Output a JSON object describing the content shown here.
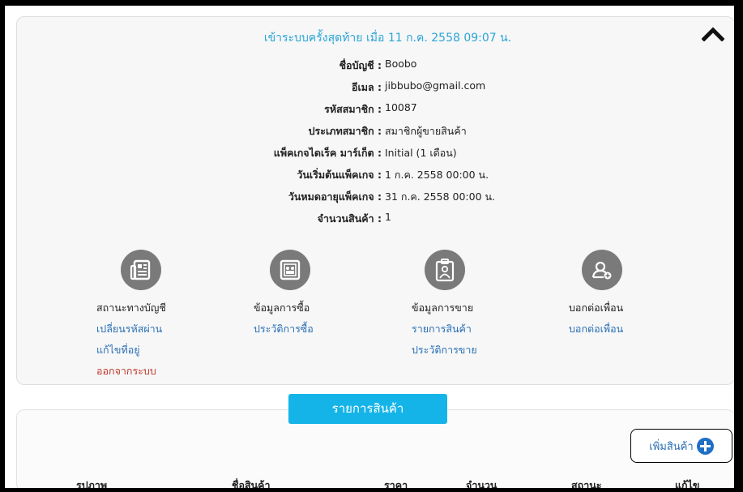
{
  "last_login": "เข้าระบบครั้งสุดท้าย เมื่อ 11 ก.ค. 2558 09:07 น.",
  "account": [
    {
      "label": "ชื่อบัญชี :",
      "value": "Boobo"
    },
    {
      "label": "อีเมล :",
      "value": "jibbubo@gmail.com"
    },
    {
      "label": "รหัสสมาชิก :",
      "value": "10087"
    },
    {
      "label": "ประเภทสมาชิก :",
      "value": "สมาชิกผู้ขายสินค้า"
    },
    {
      "label": "แพ็คเกจไดเร็ค มาร์เก็ต :",
      "value": "Initial (1 เดือน)"
    },
    {
      "label": "วันเริ่มต้นแพ็คเกจ :",
      "value": "1 ก.ค. 2558 00:00 น."
    },
    {
      "label": "วันหมดอายุแพ็คเกจ :",
      "value": "31 ก.ค. 2558 00:00 น."
    },
    {
      "label": "จำนวนสินค้า :",
      "value": "1"
    }
  ],
  "menu": {
    "account": {
      "icon": "newspaper-icon",
      "title": "สถานะทางบัญชี",
      "links": [
        "เปลี่ยนรหัสผ่าน",
        "แก้ไขที่อยู่",
        "ออกจากระบบ"
      ]
    },
    "purchase": {
      "icon": "gallery-icon",
      "title": "ข้อมูลการซื้อ",
      "links": [
        "ประวัติการซื้อ"
      ]
    },
    "sales": {
      "icon": "clipboard-person-icon",
      "title": "ข้อมูลการขาย",
      "links": [
        "รายการสินค้า",
        "ประวัติการขาย"
      ]
    },
    "invite": {
      "icon": "add-user-icon",
      "title": "บอกต่อเพื่อน",
      "links": [
        "บอกต่อเพื่อน"
      ]
    }
  },
  "products": {
    "tab_label": "รายการสินค้า",
    "add_label": "เพิ่มสินค้า",
    "columns": [
      "รูปภาพ",
      "ชื่อสินค้า",
      "ราคา",
      "จำนวน",
      "สถานะ",
      "แก้ไข"
    ]
  },
  "colors": {
    "accent": "#15b4e8",
    "link": "#2a6fb5",
    "logout": "#c0392b",
    "heading": "#2aa4d8"
  }
}
